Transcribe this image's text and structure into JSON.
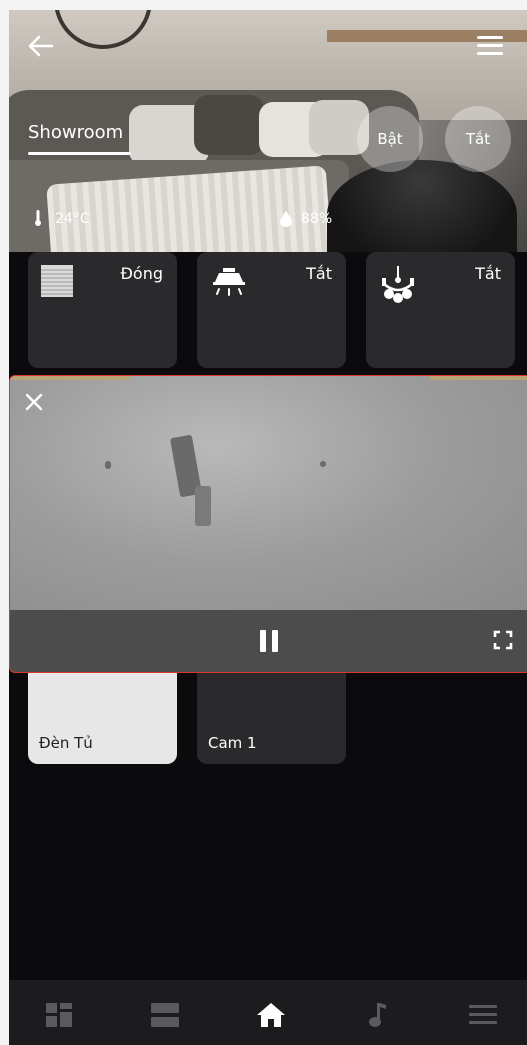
{
  "room": {
    "name": "Showroom",
    "btn_on": "Bật",
    "btn_off": "Tắt",
    "temperature": "24°C",
    "humidity": "88%"
  },
  "devices": [
    {
      "status": "Đóng",
      "icon": "blinds-icon"
    },
    {
      "status": "Tắt",
      "icon": "ceiling-light-icon"
    },
    {
      "status": "Tắt",
      "icon": "chandelier-icon"
    },
    {
      "label": "Đèn Tủ",
      "icon": "light-icon"
    },
    {
      "label": "Cam 1",
      "icon": "camera-icon"
    }
  ],
  "video": {
    "close_icon": "close-icon",
    "pause_icon": "pause-icon",
    "fullscreen_icon": "fullscreen-icon"
  },
  "nav": [
    {
      "icon": "dashboard-icon",
      "active": false
    },
    {
      "icon": "rooms-icon",
      "active": false
    },
    {
      "icon": "home-icon",
      "active": true
    },
    {
      "icon": "music-icon",
      "active": false
    },
    {
      "icon": "menu-icon",
      "active": false
    }
  ],
  "colors": {
    "background": "#0b0b0d",
    "card": "#2a2a2c",
    "card_light": "#e7e7e7",
    "video_border": "#e0342f",
    "nav_bg": "#1c1c1e",
    "nav_active": "#ffffff",
    "nav_inactive": "#5b5b5e"
  }
}
